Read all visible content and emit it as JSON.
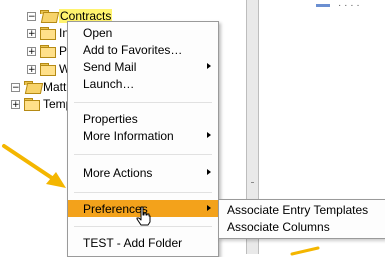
{
  "tree": {
    "items": [
      {
        "expander": "−",
        "label": "Contracts",
        "selected": true,
        "open": true
      },
      {
        "expander": "+",
        "label": "In",
        "selected": false,
        "open": false
      },
      {
        "expander": "+",
        "label": "P",
        "selected": false,
        "open": false
      },
      {
        "expander": "+",
        "label": "W",
        "selected": false,
        "open": false
      },
      {
        "expander": "−",
        "label": "Matt",
        "selected": false,
        "open": true
      },
      {
        "expander": "+",
        "label": "Temp",
        "selected": false,
        "open": false
      }
    ]
  },
  "context_menu": {
    "items": [
      {
        "label": "Open",
        "has_submenu": false
      },
      {
        "label": "Add to Favorites…",
        "has_submenu": false
      },
      {
        "label": "Send Mail",
        "has_submenu": true
      },
      {
        "label": "Launch…",
        "has_submenu": false
      },
      {
        "label": "Properties",
        "has_submenu": false
      },
      {
        "label": "More Information",
        "has_submenu": true
      },
      {
        "label": "More Actions",
        "has_submenu": true
      },
      {
        "label": "Preferences",
        "has_submenu": true,
        "highlighted": true
      },
      {
        "label": "TEST - Add Folder",
        "has_submenu": false
      }
    ],
    "highlight_color": "#f3a21b"
  },
  "submenu": {
    "items": [
      {
        "label": "Associate Entry Templates"
      },
      {
        "label": "Associate Columns"
      }
    ]
  },
  "annotation": {
    "arrow_color": "#f4b600"
  },
  "icons": [
    "folder-icon",
    "folder-open-icon",
    "submenu-arrow-icon",
    "hand-cursor-icon",
    "annotation-arrow"
  ]
}
